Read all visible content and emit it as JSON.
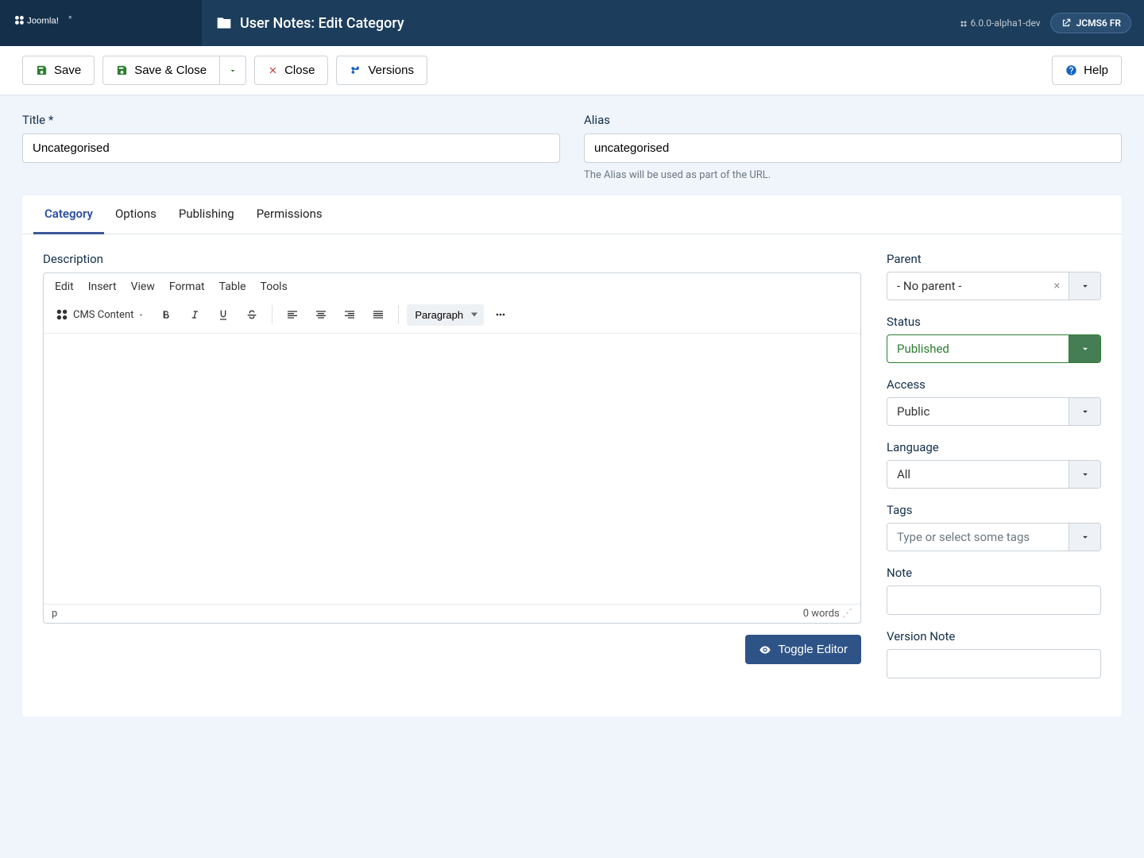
{
  "header": {
    "brand": "Joomla!",
    "title": "User Notes: Edit Category",
    "version": "6.0.0-alpha1-dev",
    "badge": "JCMS6 FR"
  },
  "toolbar": {
    "save": "Save",
    "save_close": "Save & Close",
    "close": "Close",
    "versions": "Versions",
    "help": "Help"
  },
  "form": {
    "title_label": "Title *",
    "title_value": "Uncategorised",
    "alias_label": "Alias",
    "alias_value": "uncategorised",
    "alias_hint": "The Alias will be used as part of the URL."
  },
  "tabs": {
    "category": "Category",
    "options": "Options",
    "publishing": "Publishing",
    "permissions": "Permissions"
  },
  "editor": {
    "description_label": "Description",
    "menu": {
      "edit": "Edit",
      "insert": "Insert",
      "view": "View",
      "format": "Format",
      "table": "Table",
      "tools": "Tools"
    },
    "cms_content": "CMS Content",
    "paragraph": "Paragraph",
    "path": "p",
    "wordcount": "0 words",
    "toggle": "Toggle Editor"
  },
  "sidebar": {
    "parent": {
      "label": "Parent",
      "value": "- No parent -"
    },
    "status": {
      "label": "Status",
      "value": "Published"
    },
    "access": {
      "label": "Access",
      "value": "Public"
    },
    "language": {
      "label": "Language",
      "value": "All"
    },
    "tags": {
      "label": "Tags",
      "placeholder": "Type or select some tags"
    },
    "note": {
      "label": "Note"
    },
    "version_note": {
      "label": "Version Note"
    }
  }
}
